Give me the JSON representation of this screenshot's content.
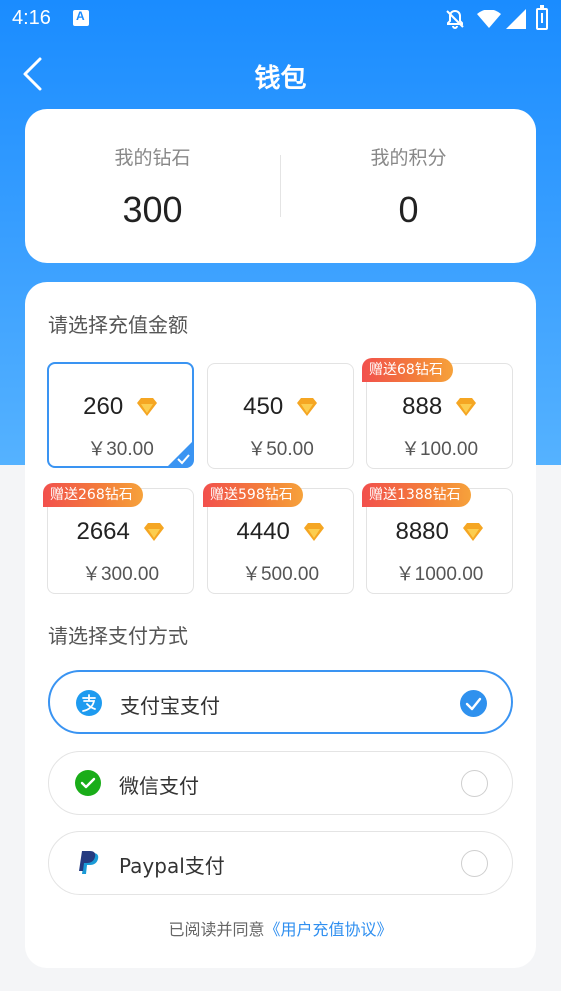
{
  "status_bar": {
    "time": "4:16"
  },
  "header": {
    "title": "钱包"
  },
  "stats": {
    "diamonds_label": "我的钻石",
    "diamonds_value": "300",
    "points_label": "我的积分",
    "points_value": "0"
  },
  "recharge": {
    "title": "请选择充值金额",
    "packages": [
      {
        "amount": "260",
        "price": "￥30.00",
        "badge": "",
        "selected": true
      },
      {
        "amount": "450",
        "price": "￥50.00",
        "badge": "",
        "selected": false
      },
      {
        "amount": "888",
        "price": "￥100.00",
        "badge": "赠送68钻石",
        "selected": false
      },
      {
        "amount": "2664",
        "price": "￥300.00",
        "badge": "赠送268钻石",
        "selected": false
      },
      {
        "amount": "4440",
        "price": "￥500.00",
        "badge": "赠送598钻石",
        "selected": false
      },
      {
        "amount": "8880",
        "price": "￥1000.00",
        "badge": "赠送1388钻石",
        "selected": false
      }
    ]
  },
  "payment": {
    "title": "请选择支付方式",
    "methods": [
      {
        "label": "支付宝支付",
        "icon": "alipay-icon",
        "selected": true
      },
      {
        "label": "微信支付",
        "icon": "wechat-pay-icon",
        "selected": false
      },
      {
        "label": "Paypal支付",
        "icon": "paypal-icon",
        "selected": false
      }
    ]
  },
  "agreement": {
    "prefix": "已阅读并同意",
    "link": "《用户充值协议》"
  },
  "colors": {
    "header_blue": "#1a8cff",
    "accent_blue": "#3a94f2",
    "badge_red": "#f2504d",
    "badge_orange": "#f6a23b",
    "gem_gold": "#f5a623",
    "alipay_blue": "#1e9bf0",
    "wechat_green": "#1aad19"
  }
}
